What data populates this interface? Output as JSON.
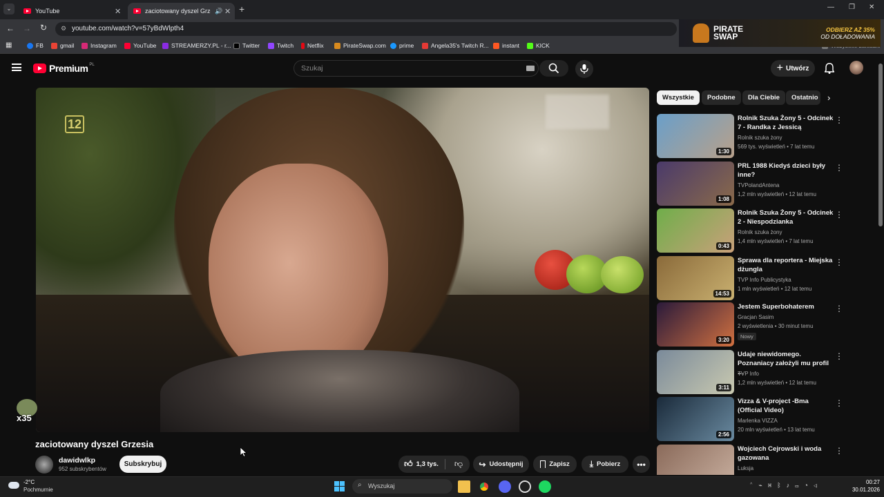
{
  "browser": {
    "tabs": [
      {
        "title": "YouTube"
      },
      {
        "title": "zaciotowany dyszel Grzesia"
      }
    ],
    "url": "youtube.com/watch?v=57yBdWlpth4",
    "bookmarks": [
      {
        "label": "FB",
        "color": "#1877f2"
      },
      {
        "label": "gmail",
        "color": "#ea4335"
      },
      {
        "label": "Instagram",
        "color": "#d62976"
      },
      {
        "label": "YouTube",
        "color": "#ff0033"
      },
      {
        "label": "STREAMERZY.PL - r...",
        "color": "#8a2be2"
      },
      {
        "label": "Twitter",
        "color": "#000000"
      },
      {
        "label": "Twitch",
        "color": "#9146ff"
      },
      {
        "label": "Netflix",
        "color": "#e50914"
      },
      {
        "label": "PirateSwap.com",
        "color": "#d88a1e"
      },
      {
        "label": "prime",
        "color": "#1a98ff"
      },
      {
        "label": "Angela35's Twitch R...",
        "color": "#e53935"
      },
      {
        "label": "instant",
        "color": "#ff5722"
      },
      {
        "label": "KICK",
        "color": "#53fc18"
      }
    ],
    "all_bookmarks": "Wszystkie zakładki"
  },
  "ad": {
    "brand_line1": "PIRATE",
    "brand_line2": "SWAP",
    "promo_line1": "ODBIERZ AŻ 35%",
    "promo_line2": "OD DOŁADOWANIA"
  },
  "youtube": {
    "logo_text": "Premium",
    "region": "PL",
    "search_placeholder": "Szukaj",
    "create_label": "Utwórz",
    "channel_logo_number": "12",
    "overlay_text": "x35",
    "video_title": "zaciotowany dyszel Grzesia",
    "channel_name": "dawidwlkp",
    "subscribers": "952 subskrybentów",
    "subscribe_label": "Subskrybuj",
    "likes": "1,3 tys.",
    "share_label": "Udostępnij",
    "save_label": "Zapisz",
    "download_label": "Pobierz",
    "chips": [
      "Wszystkie",
      "Podobne",
      "Dla Ciebie",
      "Ostatnio"
    ],
    "recommendations": [
      {
        "title": "Rolnik Szuka Żony 5 - Odcinek 7 - Randka z Jessicą",
        "channel": "Rolnik szuka żony",
        "meta": "569 tys. wyświetleń • 7 lat temu",
        "duration": "1:30",
        "thumb_colors": [
          "#6a9fc9",
          "#b8a08a"
        ]
      },
      {
        "title": "PRL 1988 Kiedyś dzieci były inne?",
        "channel": "TVPolandAntena",
        "meta": "1,2 mln wyświetleń • 12 lat temu",
        "duration": "1:08",
        "thumb_colors": [
          "#4a3a6a",
          "#8a6a4a"
        ]
      },
      {
        "title": "Rolnik Szuka Żony 5 - Odcinek 2 - Niespodzianka",
        "channel": "Rolnik szuka żony",
        "meta": "1,4 mln wyświetleń • 7 lat temu",
        "duration": "0:43",
        "thumb_colors": [
          "#6fae4a",
          "#c9a07a"
        ]
      },
      {
        "title": "Sprawa dla reportera - Miejska dżungla",
        "channel": "TVP Info Publicystyka",
        "meta": "1 mln wyświetleń • 12 lat temu",
        "duration": "14:53",
        "thumb_colors": [
          "#8a6a3a",
          "#c9b070"
        ]
      },
      {
        "title": "Jestem Superbohaterem",
        "channel": "Gracjan Sasim",
        "meta": "2 wyświetlenia • 30 minut temu",
        "duration": "3:20",
        "badge": "Nowy",
        "thumb_colors": [
          "#2a1a3a",
          "#d07040"
        ]
      },
      {
        "title": "Udaje niewidomego. Poznaniacy założyli mu profil ...",
        "channel": "TVP Info",
        "meta": "1,2 mln wyświetleń • 12 lat temu",
        "duration": "3:11",
        "thumb_colors": [
          "#7a8a9a",
          "#c9c9b0"
        ]
      },
      {
        "title": "Vizza & V-project -Bma (Official Video)",
        "channel": "Marlenka VIZZA",
        "meta": "20 mln wyświetleń • 13 lat temu",
        "duration": "2:56",
        "thumb_colors": [
          "#1a2a3a",
          "#6a8aa0"
        ]
      },
      {
        "title": "Wojciech Cejrowski i woda gazowana",
        "channel": "Luksja",
        "meta": "",
        "duration": "",
        "thumb_colors": [
          "#8a6a5a",
          "#c9b0a0"
        ]
      }
    ]
  },
  "taskbar": {
    "temperature": "-2°C",
    "weather": "Pochmurnie",
    "search_placeholder": "Wyszukaj",
    "time": "00:27",
    "date": "30.01.2026"
  }
}
